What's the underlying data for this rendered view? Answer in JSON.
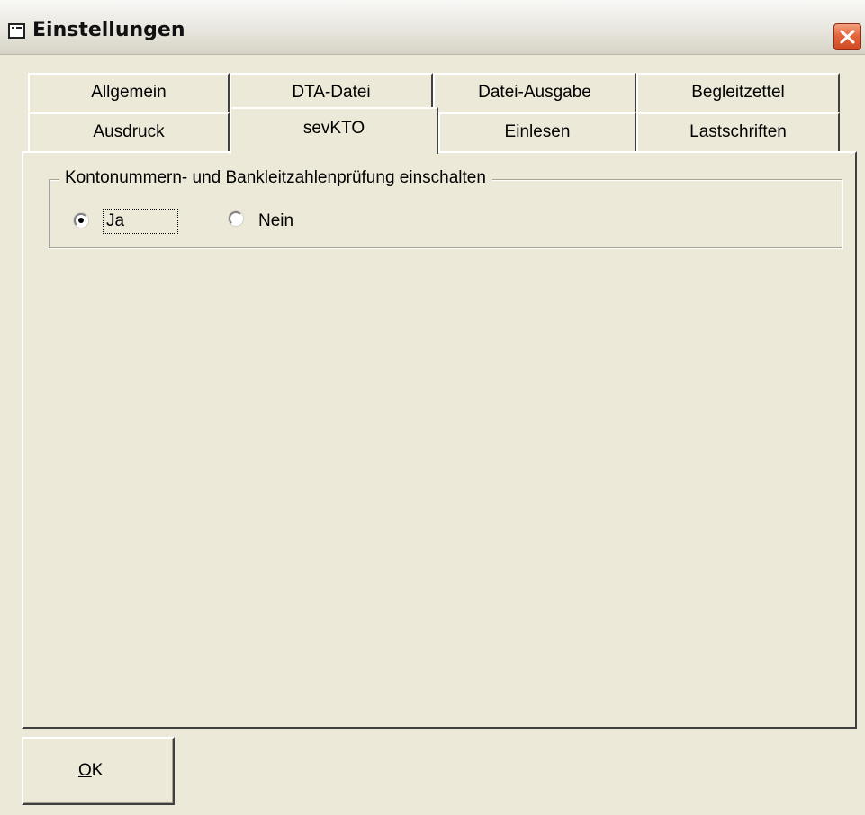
{
  "window": {
    "title": "Einstellungen",
    "icon": "form-icon",
    "close_icon": "close-icon",
    "close_color": "#e2663d"
  },
  "tabs": {
    "row1": [
      {
        "label": "Allgemein"
      },
      {
        "label": "DTA-Datei"
      },
      {
        "label": "Datei-Ausgabe"
      },
      {
        "label": "Begleitzettel"
      }
    ],
    "row2": [
      {
        "label": "Ausdruck"
      },
      {
        "label": "sevKTO"
      },
      {
        "label": "Einlesen"
      },
      {
        "label": "Lastschriften"
      }
    ],
    "active": "sevKTO"
  },
  "page": {
    "group_label": "Kontonummern- und Bankleitzahlenprüfung einschalten",
    "options": [
      {
        "label": "Ja",
        "selected": true
      },
      {
        "label": "Nein",
        "selected": false
      }
    ]
  },
  "buttons": {
    "ok_label": "OK",
    "ok_mnemonic": "O"
  }
}
